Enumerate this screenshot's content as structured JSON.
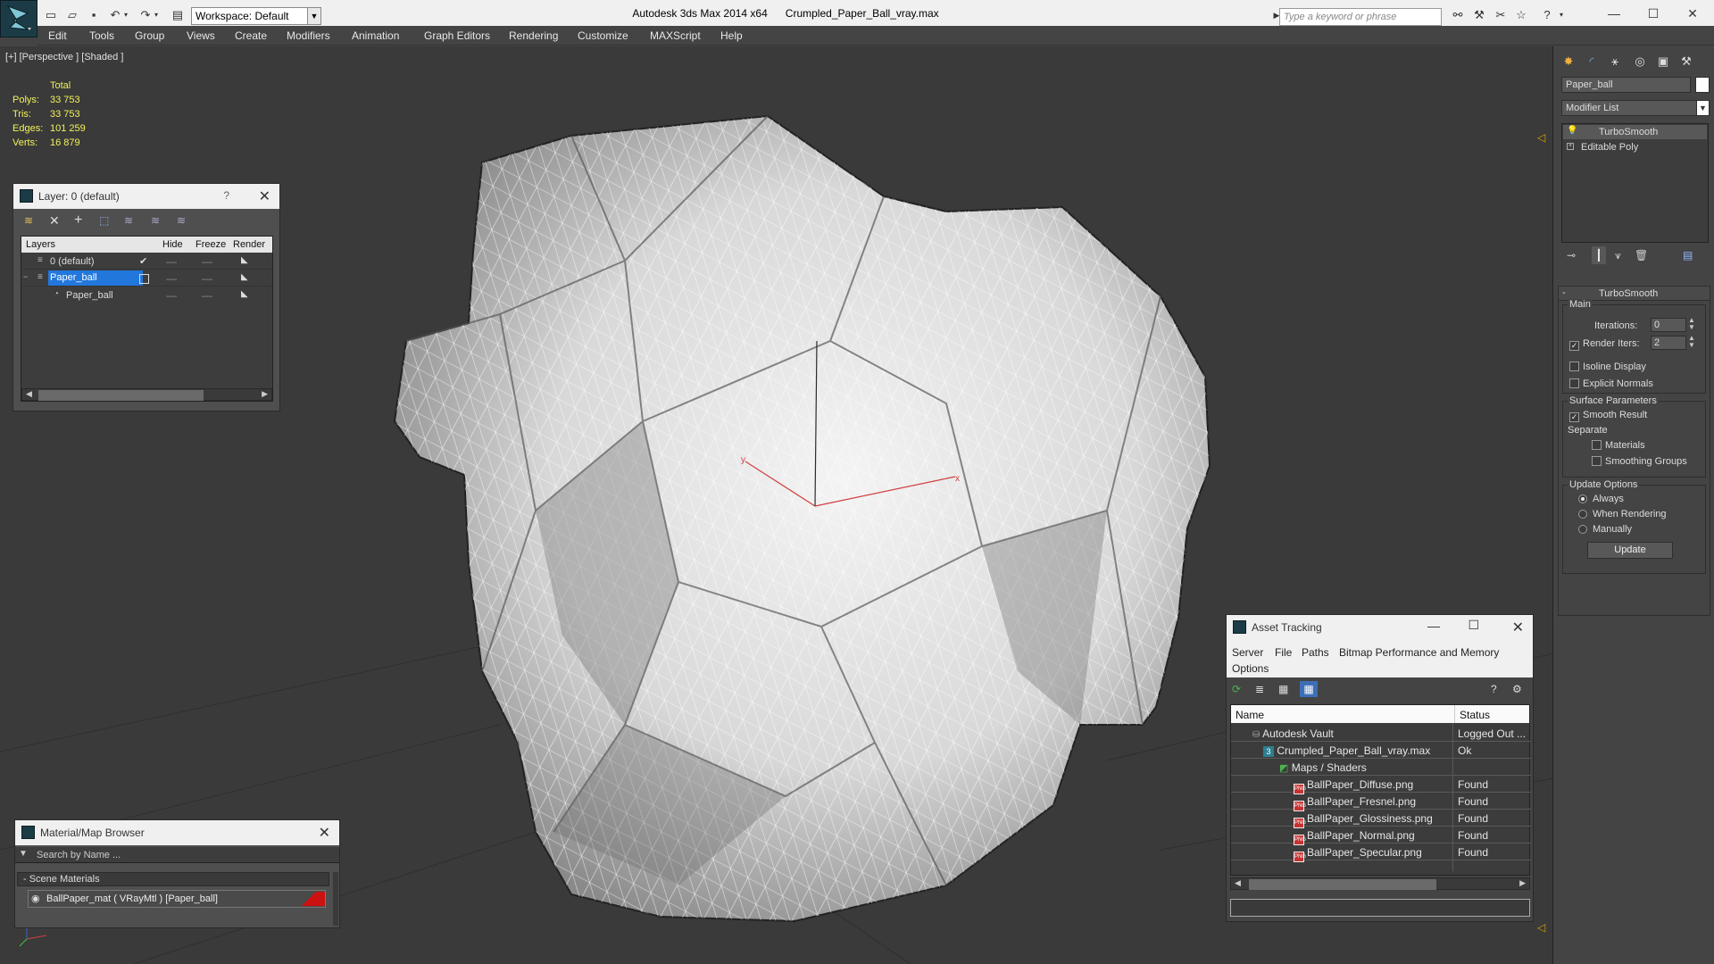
{
  "titlebar": {
    "workspace": "Workspace: Default",
    "app_title": "Autodesk 3ds Max  2014 x64",
    "file_title": "Crumpled_Paper_Ball_vray.max",
    "search_placeholder": "Type a keyword or phrase"
  },
  "menu": [
    "Edit",
    "Tools",
    "Group",
    "Views",
    "Create",
    "Modifiers",
    "Animation",
    "Graph Editors",
    "Rendering",
    "Customize",
    "MAXScript",
    "Help"
  ],
  "viewport": {
    "label": "[+] [Perspective ] [Shaded ]",
    "stats": {
      "header": "Total",
      "rows": [
        {
          "label": "Polys:",
          "value": "33 753"
        },
        {
          "label": "Tris:",
          "value": "33 753"
        },
        {
          "label": "Edges:",
          "value": "101 259"
        },
        {
          "label": "Verts:",
          "value": "16 879"
        }
      ]
    },
    "axis_x": "x",
    "axis_y": "y"
  },
  "layer_dialog": {
    "title": "Layer: 0 (default)",
    "help": "?",
    "columns": {
      "layers": "Layers",
      "hide": "Hide",
      "freeze": "Freeze",
      "render": "Render"
    },
    "rows": [
      {
        "name": "0 (default)"
      },
      {
        "name": "Paper_ball"
      },
      {
        "name": "Paper_ball"
      }
    ]
  },
  "material_browser": {
    "title": "Material/Map Browser",
    "search_placeholder": "Search by Name ...",
    "group": "- Scene Materials",
    "item": "BallPaper_mat  ( VRayMtl )  [Paper_ball]"
  },
  "asset_tracking": {
    "title": "Asset Tracking",
    "menu": [
      "Server",
      "File",
      "Paths",
      "Bitmap Performance and Memory",
      "Options"
    ],
    "columns": {
      "name": "Name",
      "status": "Status"
    },
    "rows": [
      {
        "name": "Autodesk Vault",
        "status": "Logged Out ..."
      },
      {
        "name": "Crumpled_Paper_Ball_vray.max",
        "status": "Ok"
      },
      {
        "name": "Maps / Shaders",
        "status": ""
      },
      {
        "name": "BallPaper_Diffuse.png",
        "status": "Found"
      },
      {
        "name": "BallPaper_Fresnel.png",
        "status": "Found"
      },
      {
        "name": "BallPaper_Glossiness.png",
        "status": "Found"
      },
      {
        "name": "BallPaper_Normal.png",
        "status": "Found"
      },
      {
        "name": "BallPaper_Specular.png",
        "status": "Found"
      }
    ]
  },
  "command_panel": {
    "object_name": "Paper_ball",
    "modifier_list": "Modifier List",
    "stack": [
      "TurboSmooth",
      "Editable Poly"
    ],
    "rollout_title": "TurboSmooth",
    "main_group": "Main",
    "iterations_label": "Iterations:",
    "iterations_value": "0",
    "render_iters_label": "Render Iters:",
    "render_iters_value": "2",
    "render_iters_checked": true,
    "isoline_label": "Isoline Display",
    "explicit_normals_label": "Explicit Normals",
    "surface_group": "Surface Parameters",
    "smooth_result_label": "Smooth Result",
    "separate_label": "Separate",
    "materials_label": "Materials",
    "smoothing_groups_label": "Smoothing Groups",
    "update_group": "Update Options",
    "always_label": "Always",
    "when_rendering_label": "When Rendering",
    "manually_label": "Manually",
    "update_button": "Update"
  },
  "colors": {
    "viewport_bg": "#3a3a3a",
    "stats_text": "#f2f25c",
    "selection": "#2277dd",
    "panel_bg": "#4f4f4f"
  }
}
